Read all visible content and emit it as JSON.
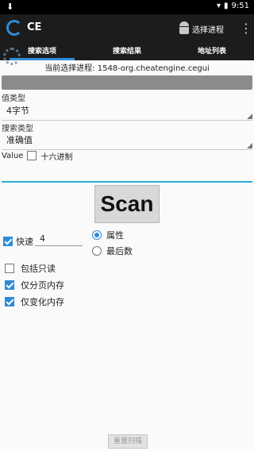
{
  "status": {
    "time": "9:51"
  },
  "app": {
    "title": "CE",
    "select_process": "选择进程"
  },
  "tabs": [
    {
      "label": "搜索选项"
    },
    {
      "label": "搜索结果"
    },
    {
      "label": "地址列表"
    }
  ],
  "process": {
    "line": "当前选择进程: 1548-org.cheatengine.cegui"
  },
  "value_type": {
    "label": "值类型",
    "selected": "4字节"
  },
  "search_type": {
    "label": "搜索类型",
    "selected": "准确值"
  },
  "value": {
    "label": "Value",
    "hex_label": "十六进制",
    "hex_checked": false,
    "input": ""
  },
  "scan": {
    "label": "Scan"
  },
  "fast": {
    "label": "快速",
    "checked": true,
    "value": "4"
  },
  "alignment": {
    "option1": "属性",
    "option2": "最后数",
    "selected": "属性"
  },
  "options": [
    {
      "label": "包括只读",
      "checked": false
    },
    {
      "label": "仅分页内存",
      "checked": true
    },
    {
      "label": "仅变化内存",
      "checked": true
    }
  ],
  "reset": {
    "label": "重置扫描"
  }
}
